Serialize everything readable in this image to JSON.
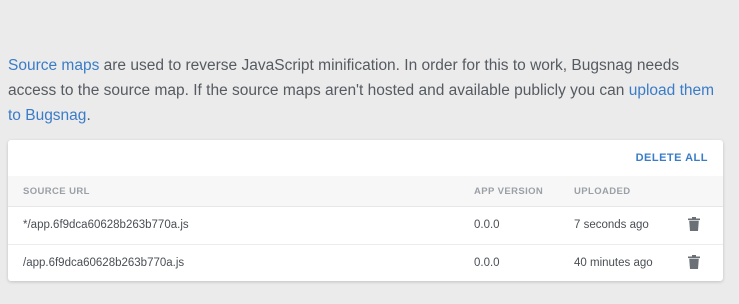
{
  "intro": {
    "link_source_maps": "Source maps",
    "text_1": " are used to reverse JavaScript minification. In order for this to work, Bugsnag needs access to the source map. If the source maps aren't hosted and available publicly you can ",
    "link_upload": "upload them to Bugsnag",
    "text_2": "."
  },
  "table": {
    "delete_all_label": "DELETE ALL",
    "headers": {
      "source_url": "SOURCE URL",
      "app_version": "APP VERSION",
      "uploaded": "UPLOADED"
    },
    "rows": [
      {
        "source_url": "*/app.6f9dca60628b263b770a.js",
        "app_version": "0.0.0",
        "uploaded": "7 seconds ago",
        "action_icon": "trash-icon"
      },
      {
        "source_url": "/app.6f9dca60628b263b770a.js",
        "app_version": "0.0.0",
        "uploaded": "40 minutes ago",
        "action_icon": "trash-icon"
      }
    ]
  },
  "colors": {
    "link": "#3a7cc8",
    "background": "#ebebeb",
    "card": "#ffffff"
  }
}
